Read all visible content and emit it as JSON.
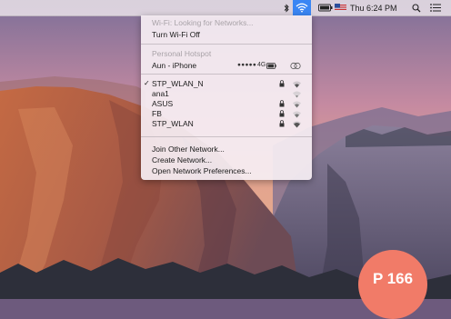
{
  "menubar": {
    "time": "Thu 6:24 PM",
    "icons": [
      "bluetooth-icon",
      "wifi-icon",
      "battery-icon",
      "flag-icon",
      "spotlight-icon",
      "list-icon"
    ],
    "wifi_active_color": "#3a86f4"
  },
  "wifi_menu": {
    "status": "Wi-Fi: Looking for Networks...",
    "toggle": "Turn Wi-Fi Off",
    "hotspot_header": "Personal Hotspot",
    "hotspot": {
      "name": "Aun - iPhone",
      "signal": "●●●●●",
      "network": "4G"
    },
    "networks": [
      {
        "name": "STP_WLAN_N",
        "checked": true
      },
      {
        "name": "ana1",
        "checked": false
      },
      {
        "name": "ASUS",
        "checked": false
      },
      {
        "name": "FB",
        "checked": false
      },
      {
        "name": "STP_WLAN",
        "checked": false
      }
    ],
    "check_mark": "✓",
    "join_other": "Join Other Network...",
    "create": "Create Network...",
    "open_prefs": "Open Network Preferences..."
  },
  "badge": {
    "text": "P 166",
    "color": "#f17b68"
  }
}
